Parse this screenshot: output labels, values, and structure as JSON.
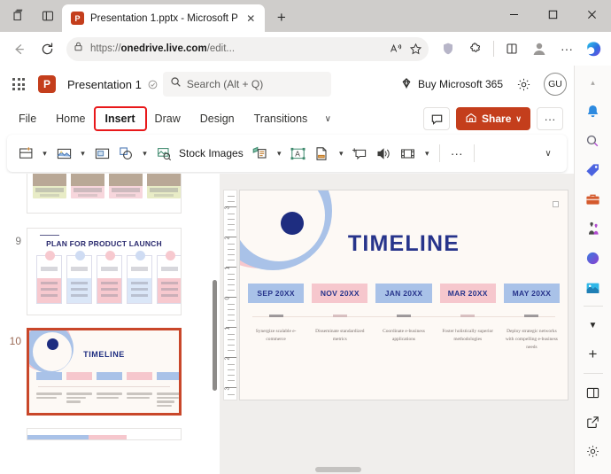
{
  "browser": {
    "tab": {
      "title": "Presentation 1.pptx - Microsoft P",
      "favicon_label": "P",
      "close_label": "✕"
    },
    "new_tab_label": "+",
    "window_controls": {
      "minimize": "‒",
      "maximize": "☐",
      "close": "✕"
    },
    "nav": {
      "back": "←",
      "reload": "↻"
    },
    "url": {
      "prefix": "https://",
      "domain": "onedrive.live.com",
      "suffix": "/edit..."
    },
    "toolbar_icons": [
      "read-aloud-icon",
      "favorite-star-icon",
      "tracking-prevention-icon",
      "extensions-icon",
      "split-screen-icon",
      "profile-icon",
      "settings-more-icon",
      "copilot-icon"
    ],
    "left_icons": [
      "collections-icon",
      "tab-actions-icon"
    ]
  },
  "ppt": {
    "app_launcher": "waffle-icon",
    "logo_label": "P",
    "doc_title": "Presentation 1",
    "saved_icon": "saved-to-cloud-icon",
    "search": {
      "placeholder": "Search (Alt + Q)",
      "icon": "search-icon"
    },
    "buy_365": {
      "label": "Buy Microsoft 365",
      "icon": "diamond-icon"
    },
    "settings_icon": "gear-icon",
    "avatar_initials": "GU",
    "ribbon_tabs": [
      {
        "label": "File",
        "active": false
      },
      {
        "label": "Home",
        "active": false
      },
      {
        "label": "Insert",
        "active": true
      },
      {
        "label": "Draw",
        "active": false
      },
      {
        "label": "Design",
        "active": false
      },
      {
        "label": "Transitions",
        "active": false
      }
    ],
    "ribbon_tabs_overflow": "∨",
    "highlight_color": "#e8181a",
    "comment_button": "comment-icon",
    "share_button": {
      "label": "Share",
      "chevron": "∨",
      "color": "#c43e1c"
    },
    "more_options_button": "···",
    "ribbon_tools": [
      {
        "name": "new-slide-tool",
        "chevron": true
      },
      {
        "name": "picture-tool",
        "chevron": true
      },
      {
        "name": "screenshot-tool",
        "chevron": false
      },
      {
        "name": "shapes-tool",
        "chevron": true
      },
      {
        "name": "stock-images-tool",
        "label": "Stock Images",
        "chevron": false
      },
      {
        "name": "smartart-tool",
        "chevron": true
      },
      {
        "name": "text-box-tool",
        "chevron": false
      },
      {
        "name": "header-footer-tool",
        "chevron": true
      },
      {
        "name": "comment-tool",
        "chevron": false
      },
      {
        "name": "audio-tool",
        "chevron": false
      },
      {
        "name": "video-tool",
        "chevron": true
      },
      {
        "name": "more-tools",
        "label": "···",
        "chevron": false
      }
    ],
    "ribbon_collapse": "∨"
  },
  "thumbnails": [
    {
      "number": "",
      "name": "slide-thumb-8",
      "selected": false,
      "title": ""
    },
    {
      "number": "9",
      "name": "slide-thumb-9",
      "selected": false,
      "title": "PLAN FOR PRODUCT LAUNCH"
    },
    {
      "number": "10",
      "name": "slide-thumb-10",
      "selected": true,
      "title": "TIMELINE"
    }
  ],
  "slide": {
    "title": "TIMELINE",
    "milestones": [
      {
        "date": "SEP 20XX",
        "color": "blue",
        "description": "Synergize scalable e-commerce"
      },
      {
        "date": "NOV 20XX",
        "color": "pink",
        "description": "Disseminate standardized metrics"
      },
      {
        "date": "JAN 20XX",
        "color": "blue",
        "description": "Coordinate e-business applications"
      },
      {
        "date": "MAR 20XX",
        "color": "pink",
        "description": "Foster holistically superior methodologies"
      },
      {
        "date": "MAY 20XX",
        "color": "blue",
        "description": "Deploy strategic networks with compelling e-business needs"
      }
    ],
    "accent_blue": "#a9c2e8",
    "accent_pink": "#f6c7cd",
    "title_color": "#27348b"
  },
  "ruler": {
    "labels": [
      "3",
      "2",
      "1",
      "0",
      "1",
      "2",
      "3"
    ]
  },
  "edge_sidebar": {
    "top_chevron": "▴",
    "items": [
      "notifications-bell-icon",
      "search-icon",
      "shopping-tag-icon",
      "tools-briefcase-icon",
      "games-icon",
      "microsoft-365-icon",
      "image-creator-icon"
    ],
    "dropdown": "▼",
    "add_button": "+",
    "bottom_items": [
      "split-pane-icon",
      "open-in-new-icon",
      "sidebar-settings-icon"
    ]
  }
}
